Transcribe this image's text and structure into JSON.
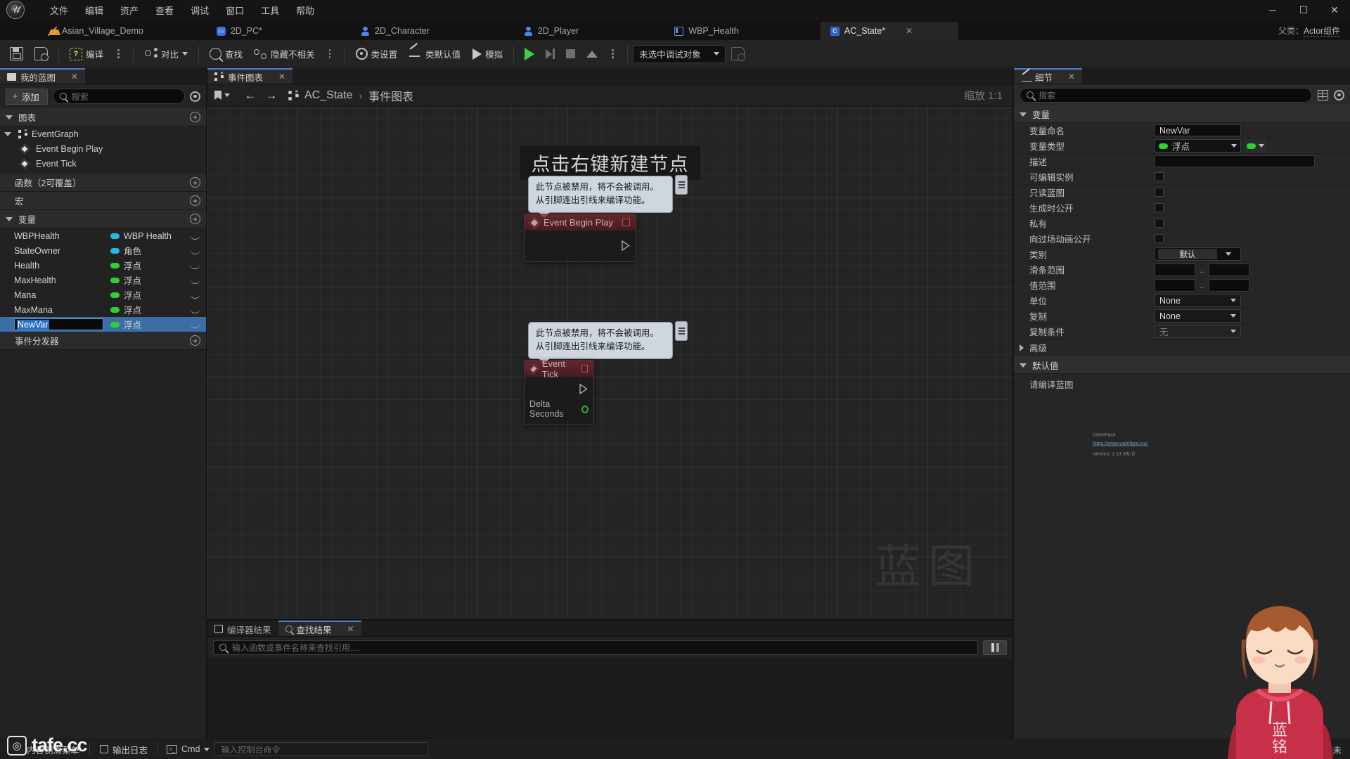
{
  "window": {
    "logo_alt": "unreal-engine-logo",
    "minimize": "─",
    "maximize": "☐",
    "close": "✕"
  },
  "menubar": {
    "items": [
      {
        "label": "文件"
      },
      {
        "label": "编辑"
      },
      {
        "label": "资产"
      },
      {
        "label": "查看"
      },
      {
        "label": "调试"
      },
      {
        "label": "窗口"
      },
      {
        "label": "工具"
      },
      {
        "label": "帮助"
      }
    ]
  },
  "asset_tabs": {
    "tabs": [
      {
        "label": "Asian_Village_Demo",
        "icon": "mountain-icon",
        "active": false
      },
      {
        "label": "2D_PC*",
        "icon": "gamepad-icon",
        "active": false
      },
      {
        "label": "2D_Character",
        "icon": "person-icon",
        "active": false
      },
      {
        "label": "2D_Player",
        "icon": "person-icon",
        "active": false
      },
      {
        "label": "WBP_Health",
        "icon": "widget-icon",
        "active": false
      },
      {
        "label": "AC_State*",
        "icon": "component-icon",
        "active": true,
        "close": "✕"
      }
    ],
    "parent_class_label": "父类：",
    "parent_class_value": "Actor组件"
  },
  "toolbar": {
    "save_label": "",
    "browse_label": "",
    "compile_label": "编译",
    "diff_label": "对比",
    "find_label": "查找",
    "hide_unrelated_label": "隐藏不相关",
    "class_settings_label": "类设置",
    "class_defaults_label": "类默认值",
    "simulate_label": "模拟",
    "debug_object": "未选中调试对象",
    "compile_badge": "?"
  },
  "my_blueprint": {
    "tab_label": "我的蓝图",
    "tab_close": "✕",
    "add_label": "添加",
    "search_placeholder": "搜索",
    "sections": {
      "graphs": "图表",
      "functions": "函数（2可覆盖）",
      "macros": "宏",
      "variables": "变量",
      "event_dispatchers": "事件分发器"
    },
    "graph_tree": {
      "root": "EventGraph",
      "children": [
        {
          "label": "Event Begin Play"
        },
        {
          "label": "Event Tick"
        }
      ]
    },
    "variables": [
      {
        "name": "WBPHealth",
        "type": "WBP Health",
        "color": "#27b9e8",
        "selected": false
      },
      {
        "name": "StateOwner",
        "type": "角色",
        "color": "#27b9e8",
        "selected": false
      },
      {
        "name": "Health",
        "type": "浮点",
        "color": "#2fd12f",
        "selected": false
      },
      {
        "name": "MaxHealth",
        "type": "浮点",
        "color": "#2fd12f",
        "selected": false
      },
      {
        "name": "Mana",
        "type": "浮点",
        "color": "#2fd12f",
        "selected": false
      },
      {
        "name": "MaxMana",
        "type": "浮点",
        "color": "#2fd12f",
        "selected": false
      },
      {
        "name": "NewVar",
        "type": "浮点",
        "color": "#2fd12f",
        "selected": true,
        "editing": true
      }
    ]
  },
  "graph": {
    "tab_label": "事件图表",
    "tab_close": "✕",
    "breadcrumb_root": "AC_State",
    "breadcrumb_sep": "›",
    "breadcrumb_leaf": "事件图表",
    "zoom_label": "缩放 1:1",
    "hint": "点击右键新建节点",
    "watermark": "蓝图",
    "disabled_note_line1": "此节点被禁用，将不会被调用。",
    "disabled_note_line2": "从引脚连出引线来编译功能。",
    "nodes": [
      {
        "title": "Event Begin Play",
        "disabled": true,
        "pins": []
      },
      {
        "title": "Event Tick",
        "disabled": true,
        "pins": [
          {
            "label": "Delta Seconds",
            "color": "#2fd12f"
          }
        ]
      }
    ]
  },
  "bottom_dock": {
    "tabs": [
      {
        "label": "编译器结果",
        "active": false
      },
      {
        "label": "查找结果",
        "active": true,
        "close": "✕"
      }
    ],
    "find_placeholder": "输入函数或事件名称来查找引用...."
  },
  "details": {
    "tab_label": "细节",
    "tab_close": "✕",
    "search_placeholder": "搜索",
    "section_variable": "变量",
    "section_default_value": "默认值",
    "advanced": "高级",
    "compile_note": "请编译蓝图",
    "rows": [
      {
        "label": "变量命名",
        "kind": "text",
        "value": "NewVar"
      },
      {
        "label": "变量类型",
        "kind": "type",
        "value": "浮点",
        "color": "#2fd12f"
      },
      {
        "label": "描述",
        "kind": "text_wide",
        "value": ""
      },
      {
        "label": "可编辑实例",
        "kind": "checkbox",
        "checked": false
      },
      {
        "label": "只读蓝图",
        "kind": "checkbox",
        "checked": false
      },
      {
        "label": "生成时公开",
        "kind": "checkbox",
        "checked": false
      },
      {
        "label": "私有",
        "kind": "checkbox",
        "checked": false
      },
      {
        "label": "向过场动画公开",
        "kind": "checkbox",
        "checked": false
      },
      {
        "label": "类别",
        "kind": "category",
        "value": "默认"
      },
      {
        "label": "滑条范围",
        "kind": "range",
        "min": "",
        "max": ""
      },
      {
        "label": "值范围",
        "kind": "range",
        "min": "",
        "max": ""
      },
      {
        "label": "单位",
        "kind": "dropdown",
        "value": "None"
      },
      {
        "label": "复制",
        "kind": "dropdown",
        "value": "None"
      },
      {
        "label": "复制条件",
        "kind": "dropdown_disabled",
        "value": "无"
      }
    ],
    "watermark": {
      "line1": "VSeeFace",
      "line2": "https://www.vseeface.icu/",
      "line3": "Version: 1.13.38c β"
    }
  },
  "statusbar": {
    "content_drawer": "内容侧滑菜单",
    "output_log": "输出日志",
    "cmd_label": "Cmd",
    "cmd_placeholder": "输入控制台命令",
    "right_status": "3未"
  },
  "overlay": {
    "brand": "tafe.cc"
  },
  "colors": {
    "accent_blue": "#3b6ea5",
    "float_green": "#2fd12f",
    "object_blue": "#27b9e8",
    "event_red": "#962a34",
    "compile_yellow": "#f2e85c",
    "play_green": "#3fd13f"
  }
}
